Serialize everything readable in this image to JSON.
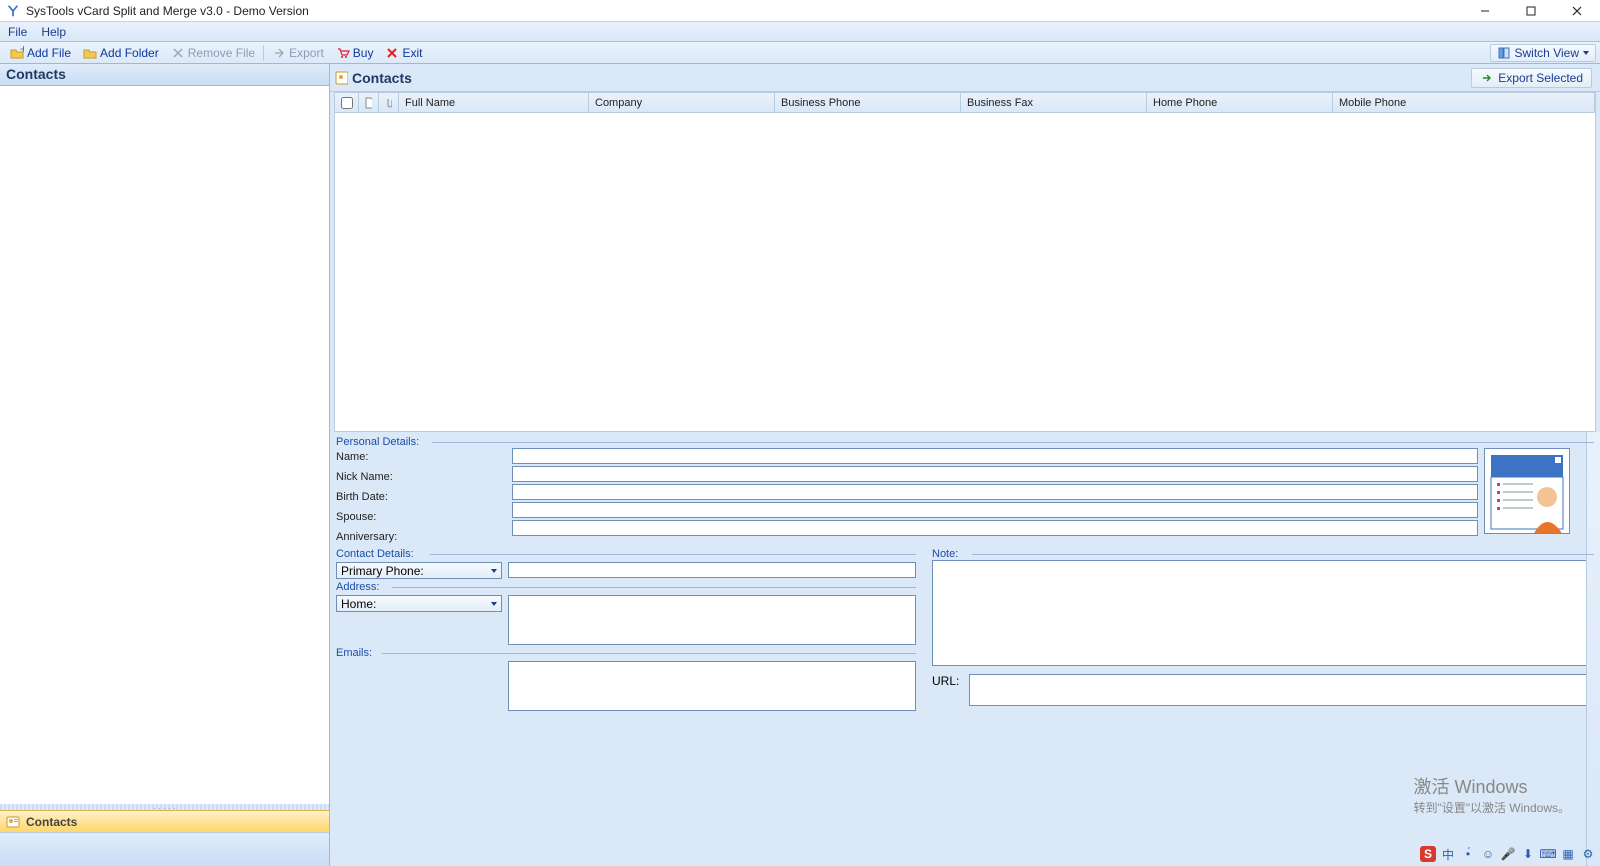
{
  "titlebar": {
    "title": "SysTools vCard Split and Merge v3.0 - Demo Version"
  },
  "menu": {
    "file": "File",
    "help": "Help"
  },
  "toolbar": {
    "add_file": "Add File",
    "add_folder": "Add Folder",
    "remove_file": "Remove File",
    "export": "Export",
    "buy": "Buy",
    "exit": "Exit",
    "switch_view": "Switch View"
  },
  "left_panel": {
    "header": "Contacts",
    "nav_item": "Contacts"
  },
  "contacts_panel": {
    "title": "Contacts",
    "export_selected": "Export Selected",
    "columns": {
      "full_name": "Full Name",
      "company": "Company",
      "business_phone": "Business Phone",
      "business_fax": "Business Fax",
      "home_phone": "Home Phone",
      "mobile_phone": "Mobile Phone"
    }
  },
  "details": {
    "personal_details_label": "Personal Details:",
    "name": "Name:",
    "nick_name": "Nick Name:",
    "birth_date": "Birth Date:",
    "spouse": "Spouse:",
    "anniversary": "Anniversary:",
    "contact_details_label": "Contact Details:",
    "primary_phone": "Primary Phone:",
    "address_label": "Address:",
    "home": "Home:",
    "emails_label": "Emails:",
    "note_label": "Note:",
    "url_label": "URL:"
  },
  "watermark": {
    "line1": "激活 Windows",
    "line2": "转到\"设置\"以激活 Windows。"
  },
  "tray": {
    "ime": "中"
  }
}
